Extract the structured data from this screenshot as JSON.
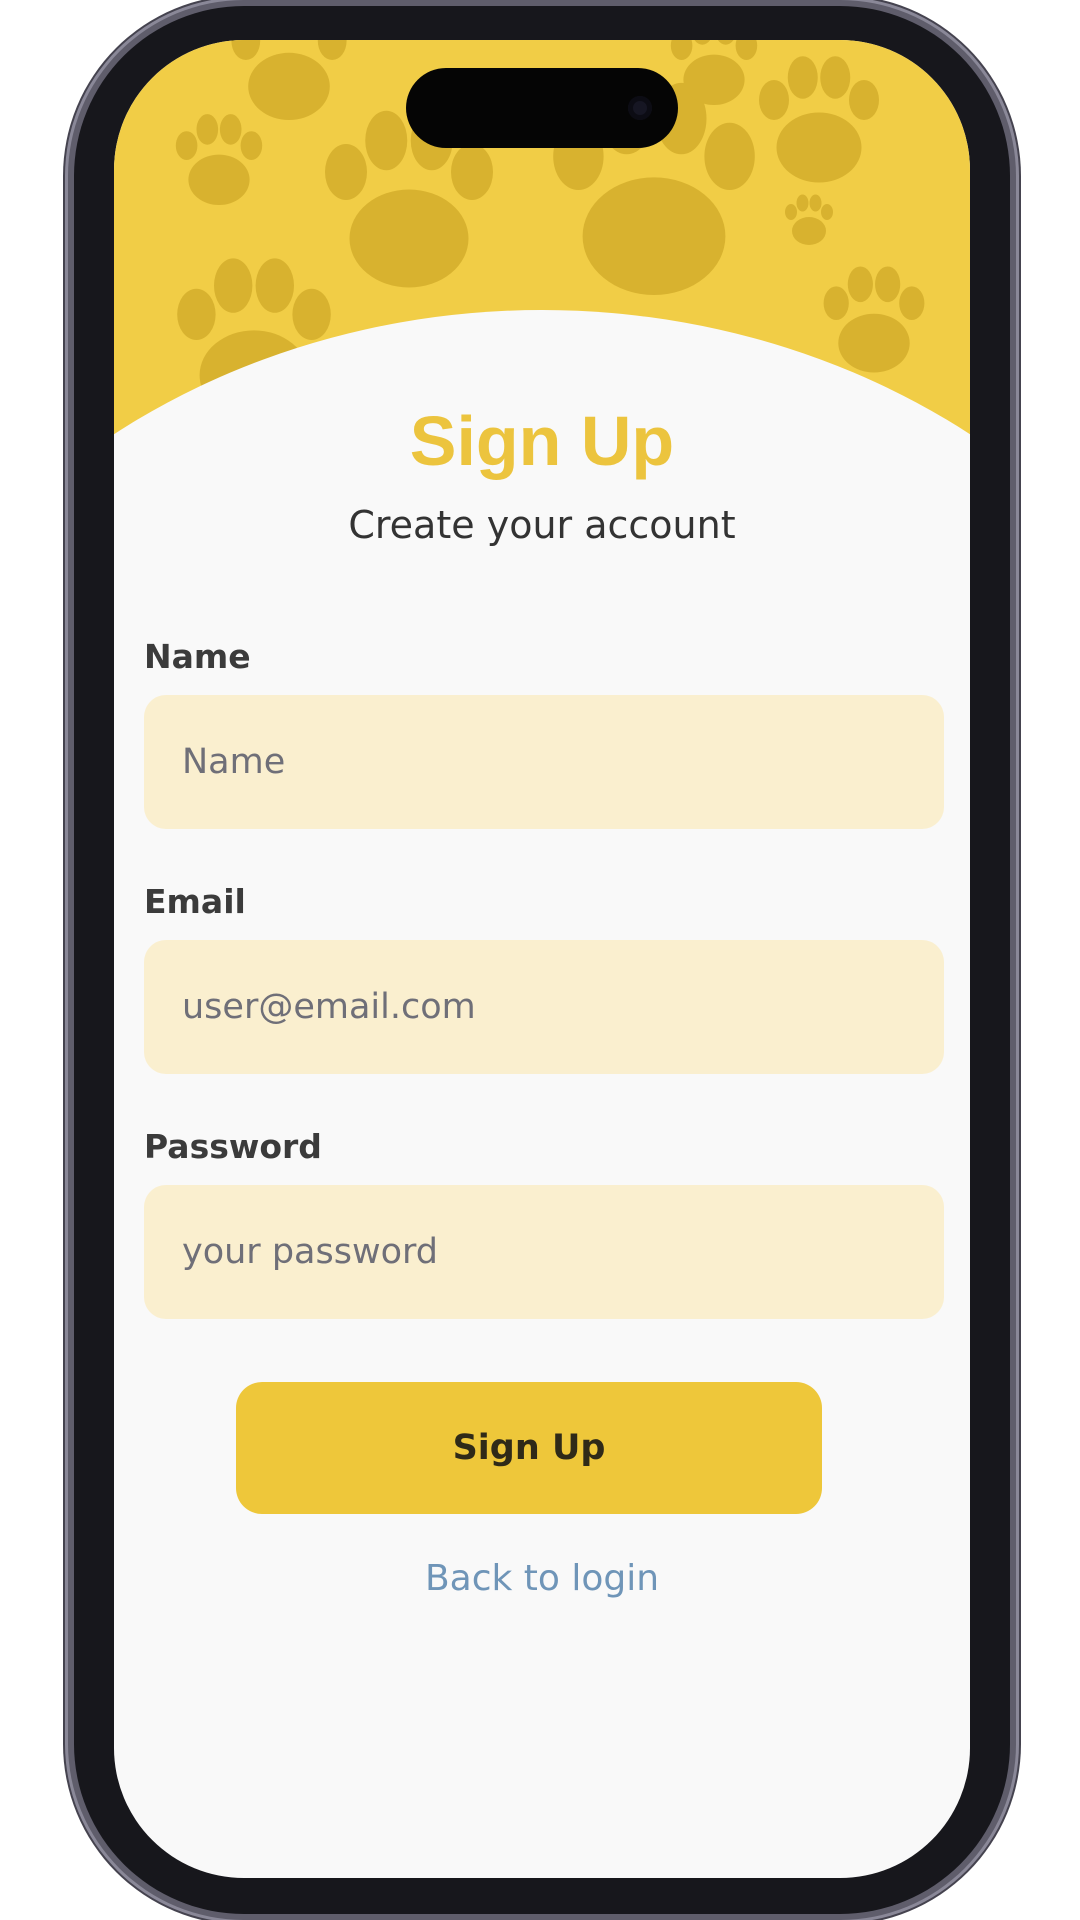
{
  "screen": {
    "title": "Sign Up",
    "subtitle": "Create your account"
  },
  "form": {
    "name": {
      "label": "Name",
      "placeholder": "Name",
      "value": ""
    },
    "email": {
      "label": "Email",
      "placeholder": "user@email.com",
      "value": ""
    },
    "password": {
      "label": "Password",
      "placeholder": "your password",
      "value": ""
    }
  },
  "actions": {
    "submit_label": "Sign Up",
    "back_link_label": "Back to login"
  },
  "theme": {
    "accent": "#f1cd46",
    "paw_color": "#d8b22f",
    "field_bg": "#faefcf",
    "link_color": "#6f95b8",
    "screen_bg": "#f9f9f9"
  },
  "decoration": {
    "header_pattern_icon": "paw-print-icon"
  }
}
